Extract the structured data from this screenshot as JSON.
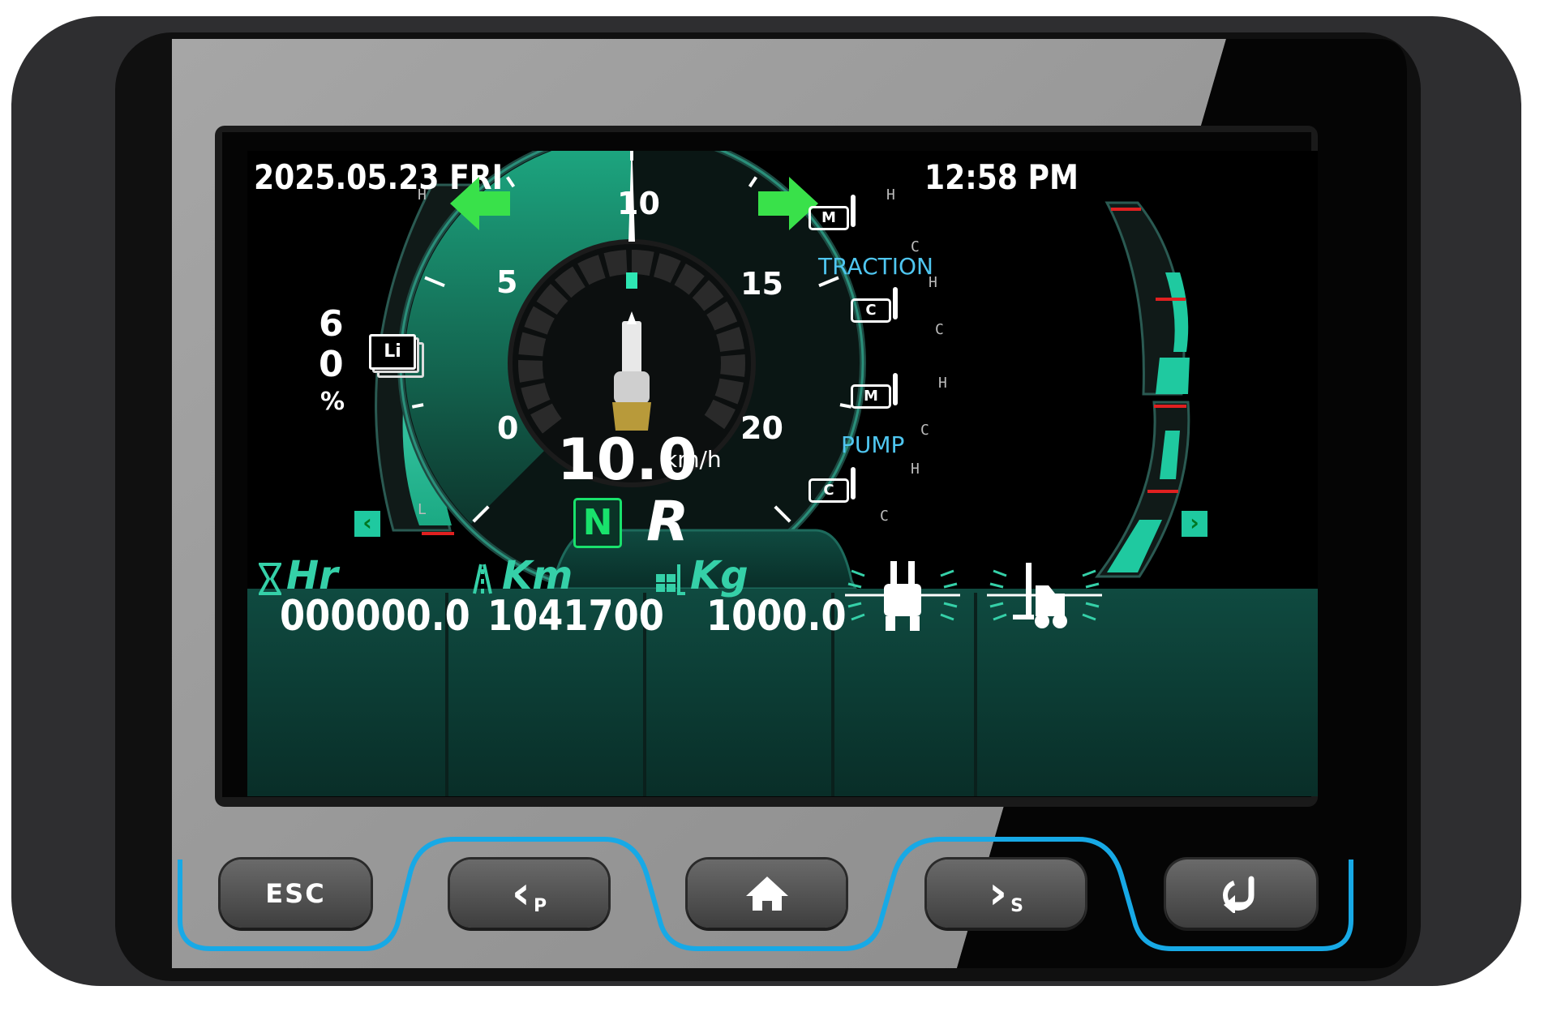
{
  "status_bar": {
    "date": "2025.05.23 FRI",
    "time": "12:58 PM"
  },
  "turn_signals": {
    "left": "left-turn-arrow-icon",
    "right": "right-turn-arrow-icon",
    "color": "#39e14a"
  },
  "battery": {
    "digit1": "6",
    "digit2": "0",
    "percent_sign": "%",
    "level_percent": 60,
    "high_label": "H",
    "low_label": "L",
    "icon_label": "Li"
  },
  "speedometer": {
    "ticks": [
      "0",
      "5",
      "10",
      "15",
      "20"
    ],
    "speed_value": "10.0",
    "speed_unit": "km/h",
    "needle_value": 10,
    "max_value": 20
  },
  "gear": {
    "neutral": "N",
    "reverse": "R",
    "active_color": "#19e26c"
  },
  "temperatures": {
    "traction_label": "TRACTION",
    "pump_label": "PUMP",
    "motor_icon_label": "M",
    "controller_icon_label": "C",
    "hot_label": "H",
    "cold_label": "C"
  },
  "stats": {
    "hours_label": "Hr",
    "hours_value": "000000.0",
    "km_label": "Km",
    "km_value": "1041700",
    "kg_label": "Kg",
    "kg_value": "1000.0"
  },
  "buttons": {
    "esc": "ESC",
    "prev_sub": "P",
    "next_sub": "S"
  },
  "colors": {
    "accent": "#1fc9a0",
    "frame_blue": "#17a9e6",
    "warning_red": "#e02020"
  }
}
